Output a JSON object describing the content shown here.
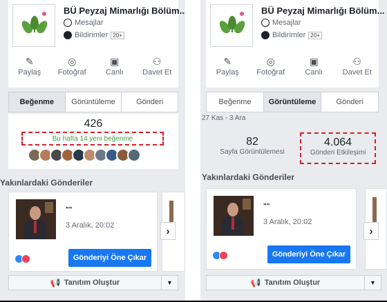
{
  "page": {
    "name": "BÜ Peyzaj Mimarlığı Bölüm...",
    "messages_label": "Mesajlar",
    "notifications_label": "Bildirimler",
    "notifications_badge": "20+"
  },
  "actions": [
    {
      "label": "Paylaş",
      "icon": "edit-icon",
      "glyph": "✎"
    },
    {
      "label": "Fotoğraf",
      "icon": "camera-icon",
      "glyph": "◎"
    },
    {
      "label": "Canlı",
      "icon": "live-video-icon",
      "glyph": "▣"
    },
    {
      "label": "Davet Et",
      "icon": "invite-user-icon",
      "glyph": "⚇"
    }
  ],
  "tabs": [
    "Beğenme",
    "Görüntüleme",
    "Gönderi"
  ],
  "left_panel": {
    "active_tab": "Beğenme",
    "likes_count": "426",
    "weekly_new_likes": "Bu hafta 14 yeni beğenme",
    "face_colors": [
      "#7a6a5a",
      "#b57c5b",
      "#4a4a4a",
      "#a0643a",
      "#2a3a4a",
      "#c08a6a",
      "#6a7a8a",
      "#3a5a8a",
      "#8a5a3a",
      "#556677"
    ]
  },
  "right_panel": {
    "active_tab": "Görüntüleme",
    "date_range": "27 Kas - 3 Ara",
    "page_views_value": "82",
    "page_views_label": "Sayfa Görüntülemesi",
    "engagement_value": "4.064",
    "engagement_label": "Gönderi Etkileşimi"
  },
  "nearby_posts": {
    "title": "Yakınlardaki Gönderiler",
    "post_title": "\"\"",
    "post_date": "3 Aralık, 20:02",
    "boost_label": "Gönderiyi Öne Çıkar",
    "next_glyph": "›"
  },
  "promo": {
    "label": "Tanıtım Oluştur",
    "icon_glyph": "📢",
    "caret_glyph": "▼"
  },
  "colors": {
    "accent_blue": "#1877f2",
    "highlight_red": "#d0202a",
    "success_green": "#42a045",
    "panel_bg": "#e9ebee"
  }
}
